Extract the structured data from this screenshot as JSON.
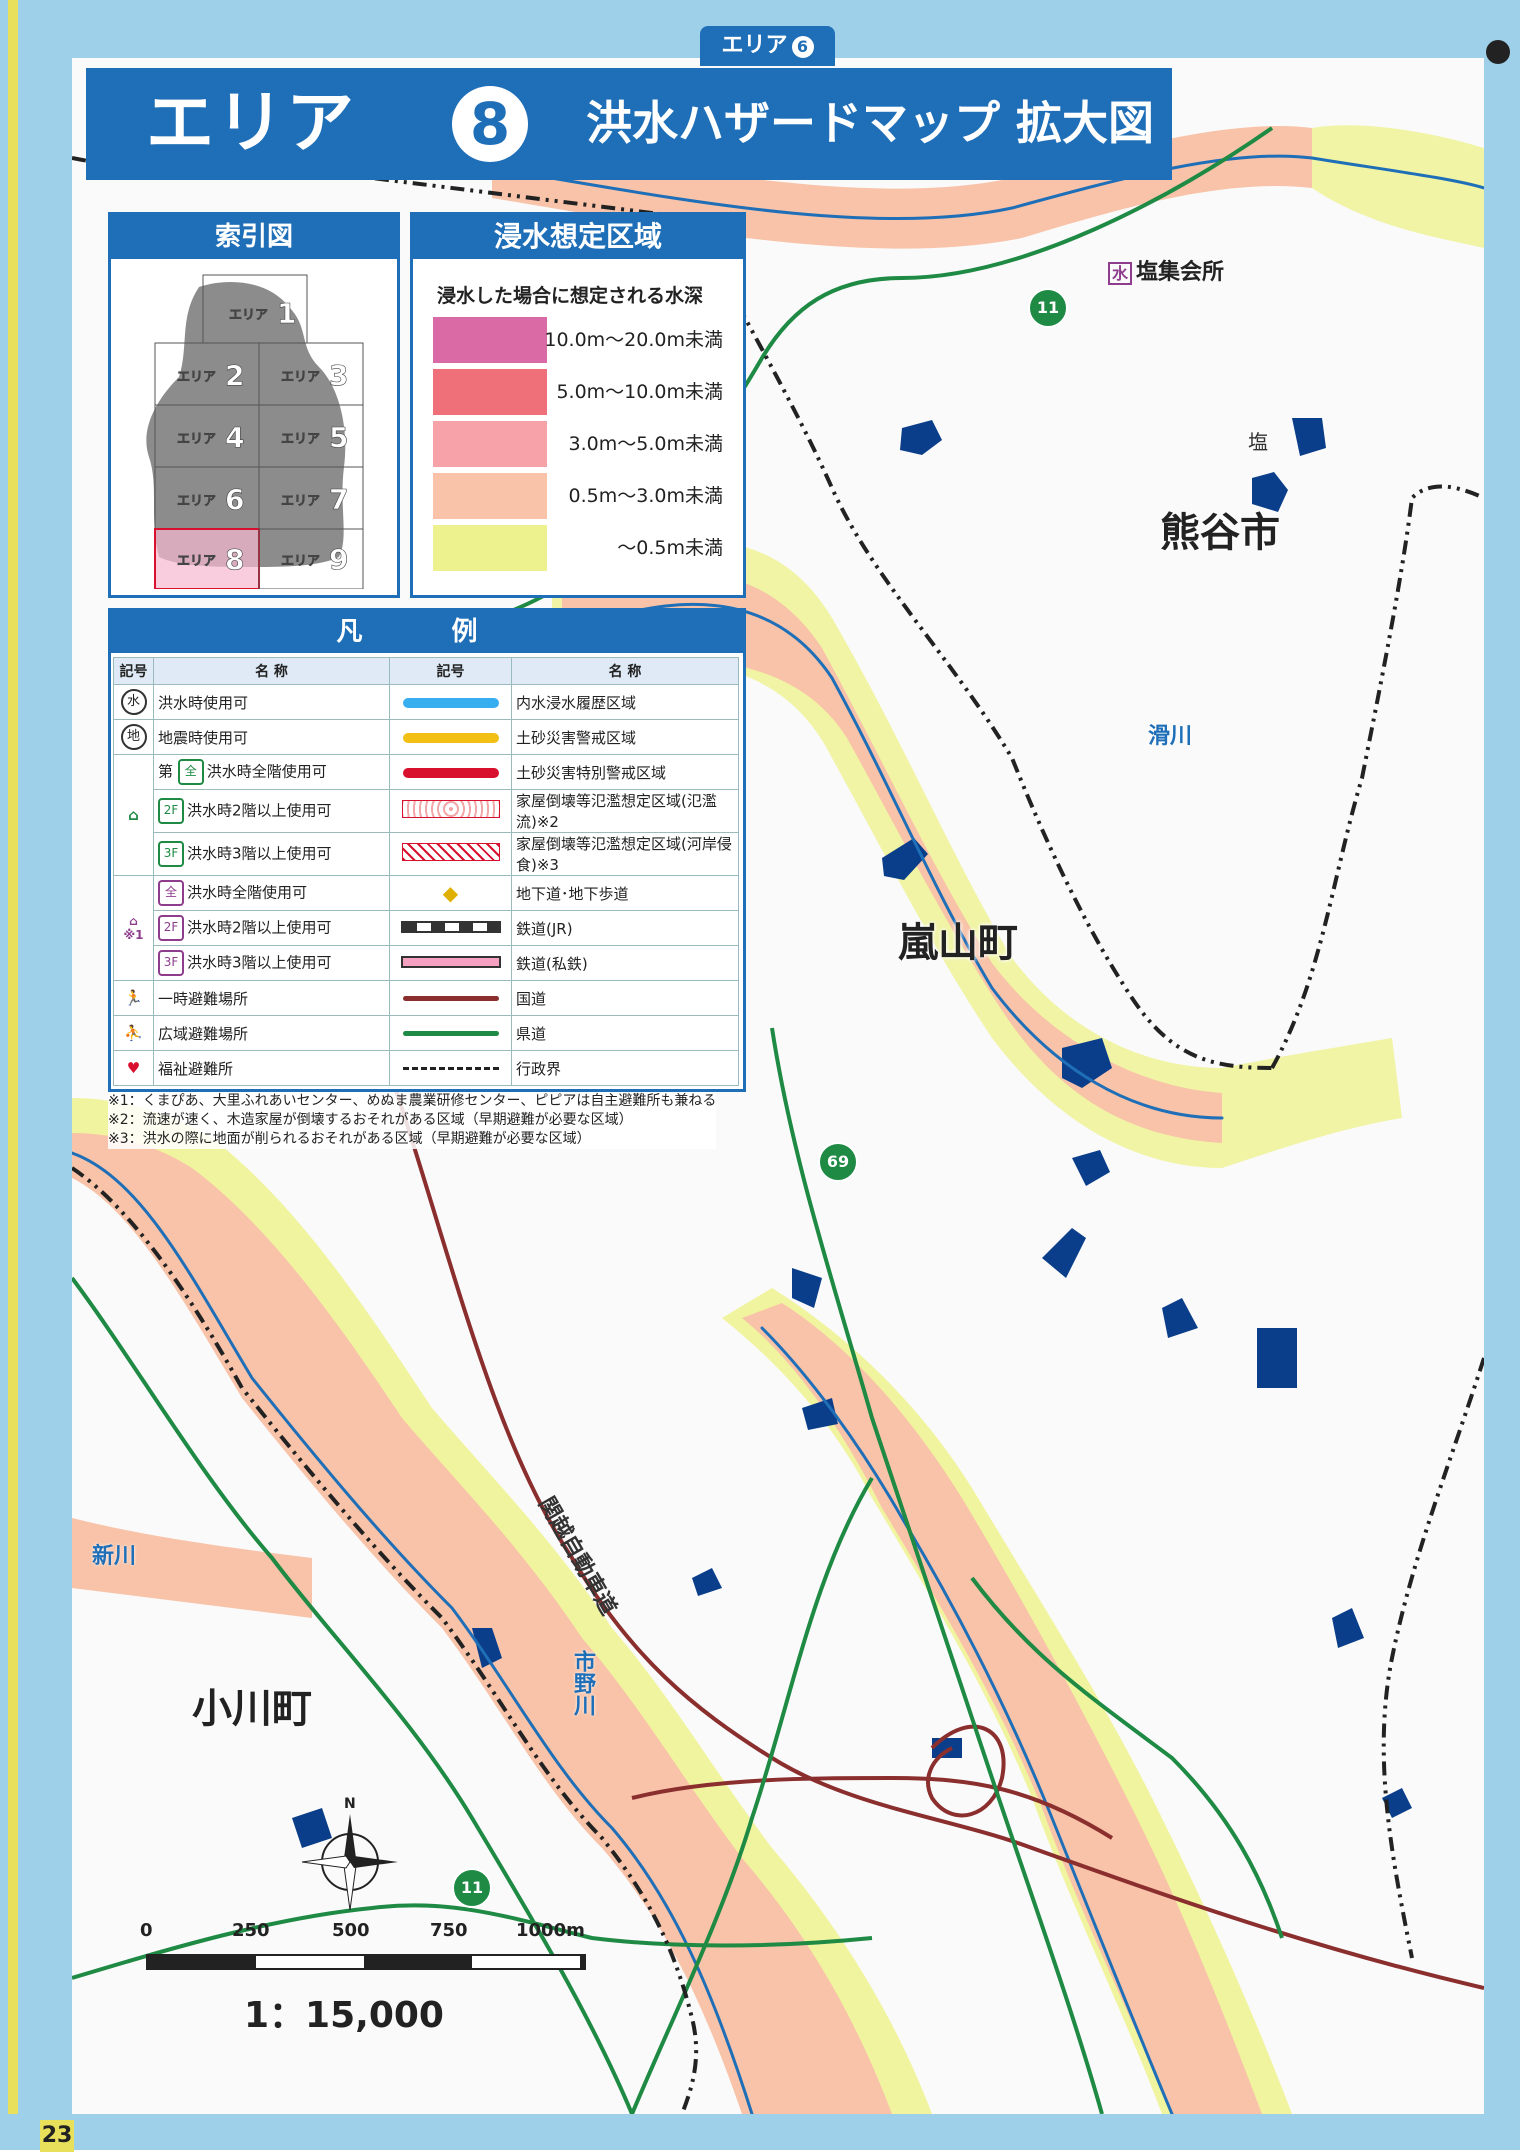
{
  "page_tab": {
    "label": "エリア",
    "num": "6"
  },
  "title": {
    "area_label": "エリア",
    "area_num": "8",
    "text": "洪水ハザードマップ 拡大図"
  },
  "index_panel": {
    "title": "索引図",
    "cells": [
      {
        "label": "エリア",
        "num": "1"
      },
      {
        "label": "エリア",
        "num": "2"
      },
      {
        "label": "エリア",
        "num": "3"
      },
      {
        "label": "エリア",
        "num": "4"
      },
      {
        "label": "エリア",
        "num": "5"
      },
      {
        "label": "エリア",
        "num": "6"
      },
      {
        "label": "エリア",
        "num": "7"
      },
      {
        "label": "エリア",
        "num": "8"
      },
      {
        "label": "エリア",
        "num": "9"
      }
    ],
    "highlight": "8"
  },
  "depth_legend": {
    "title": "浸水想定区域",
    "subtitle": "浸水した場合に想定される水深",
    "rows": [
      {
        "label": "10.0m～20.0m未満",
        "color": "#d96aa6"
      },
      {
        "label": "5.0m～10.0m未満",
        "color": "#f0707a"
      },
      {
        "label": "3.0m～5.0m未満",
        "color": "#f7a1a8"
      },
      {
        "label": "0.5m～3.0m未満",
        "color": "#f8c3a8"
      },
      {
        "label": "～0.5m未満",
        "color": "#eef28e"
      }
    ]
  },
  "hanrei": {
    "title": "凡 例",
    "headers": {
      "sym": "記号",
      "name": "名 称",
      "sym2": "記号",
      "name2": "名 称"
    },
    "left_rows": [
      {
        "sym": "水",
        "name": "洪水時使用可"
      },
      {
        "sym": "地",
        "name": "地震時使用可"
      },
      {
        "group": "第一避難所",
        "tier": "全",
        "name": "洪水時全階使用可"
      },
      {
        "group": "第一避難所",
        "tier": "2F",
        "name": "洪水時2階以上使用可"
      },
      {
        "group": "第一避難所",
        "tier": "3F",
        "name": "洪水時3階以上使用可"
      },
      {
        "group": "第二避難所",
        "tier": "全",
        "name": "洪水時全階使用可"
      },
      {
        "group": "第二避難所",
        "tier": "2F",
        "name": "洪水時2階以上使用可"
      },
      {
        "group": "第二避難所",
        "tier": "3F",
        "name": "洪水時3階以上使用可"
      },
      {
        "sym": "🏃",
        "name": "一時避難場所"
      },
      {
        "sym": "⛹",
        "name": "広域避難場所"
      },
      {
        "sym": "♥",
        "name": "福祉避難所"
      }
    ],
    "group1_label": "第一避難所",
    "group2_label": "第二避難所",
    "group2_note": "※1",
    "first": "第",
    "right_rows": [
      {
        "name": "内水浸水履歴区域",
        "color": "#37aef0"
      },
      {
        "name": "土砂災害警戒区域",
        "color": "#f2c014"
      },
      {
        "name": "土砂災害特別警戒区域",
        "color": "#d8102e"
      },
      {
        "name": "家屋倒壊等氾濫想定区域(氾濫流)",
        "note": "※2"
      },
      {
        "name": "家屋倒壊等氾濫想定区域(河岸侵食)",
        "note": "※3"
      },
      {
        "name": "地下道･地下歩道"
      },
      {
        "name": "鉄道(JR)"
      },
      {
        "name": "鉄道(私鉄)"
      },
      {
        "name": "国道",
        "color": "#8b2e2e"
      },
      {
        "name": "県道",
        "color": "#1e8a44"
      },
      {
        "name": "行政界"
      }
    ]
  },
  "notes": [
    "※1：くまぴあ、大里ふれあいセンター、めぬま農業研修センター、ピピアは自主避難所も兼ねる",
    "※2：流速が速く、木造家屋が倒壊するおそれがある区域（早期避難が必要な区域）",
    "※3：洪水の際に地面が削られるおそれがある区域（早期避難が必要な区域）"
  ],
  "places": {
    "kumagaya": "熊谷市",
    "ranzan": "嵐山町",
    "ogawa": "小川町",
    "shio_kaisho": "塩集会所",
    "shio": "塩",
    "shio_icon": "水"
  },
  "rivers": {
    "nameri": "滑川",
    "shin": "新川",
    "ichino": "市野川"
  },
  "highway": "関越自動車道",
  "route_numbers": {
    "r11a": "11",
    "r11b": "11",
    "r69": "69"
  },
  "scale": {
    "ticks": [
      "0",
      "250",
      "500",
      "750",
      "1000m"
    ],
    "ratio": "1：15,000"
  },
  "compass_letter": "N",
  "page_number": "23"
}
